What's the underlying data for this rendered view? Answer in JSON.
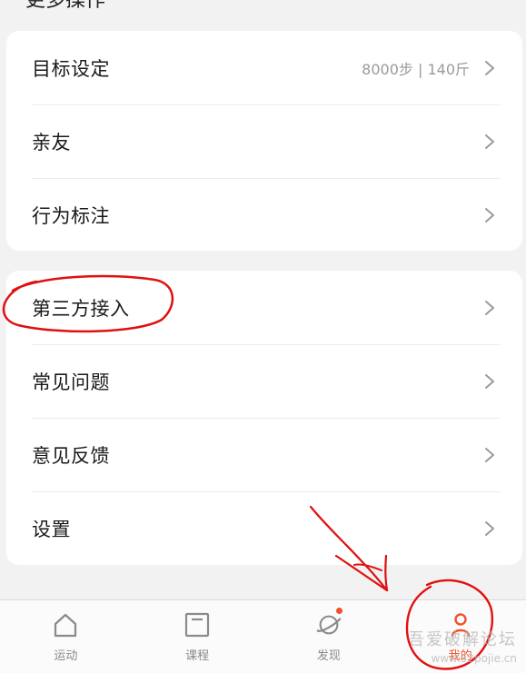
{
  "section": {
    "title": "更多操作"
  },
  "group1": [
    {
      "label": "目标设定",
      "value": "8000步 | 140斤"
    },
    {
      "label": "亲友",
      "value": ""
    },
    {
      "label": "行为标注",
      "value": ""
    }
  ],
  "group2": [
    {
      "label": "第三方接入"
    },
    {
      "label": "常见问题"
    },
    {
      "label": "意见反馈"
    },
    {
      "label": "设置"
    }
  ],
  "tabs": [
    {
      "label": "运动",
      "icon": "home-icon"
    },
    {
      "label": "课程",
      "icon": "course-icon"
    },
    {
      "label": "发现",
      "icon": "planet-icon"
    },
    {
      "label": "我的",
      "icon": "person-icon"
    }
  ],
  "watermark": {
    "line1": "吾爱破解论坛",
    "line2": "www.52pojie.cn"
  },
  "colors": {
    "accent": "#f0522b",
    "annotation": "#e01010",
    "background": "#f2f2f2",
    "card": "#ffffff"
  }
}
